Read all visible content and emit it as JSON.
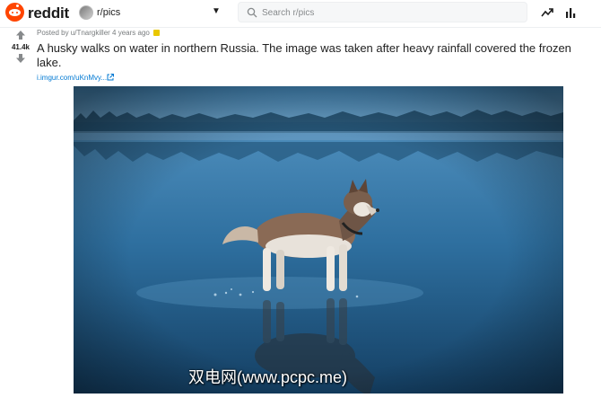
{
  "header": {
    "wordmark": "reddit",
    "subreddit": "r/pics",
    "search_placeholder": "Search r/pics",
    "icons": [
      "reddit-logo-icon",
      "chevron-down-icon",
      "search-icon",
      "trending-icon",
      "stats-icon"
    ],
    "brand_color": "#ff4500"
  },
  "post": {
    "score": "41.4k",
    "meta": "Posted by u/Tnargkiller 4 years ago",
    "title": "A husky walks on water in northern Russia. The image was taken after heavy rainfall covered the frozen lake.",
    "link_text": "i.imgur.com/uKnMvy...",
    "image_watermark": "双电网(www.pcpc.me)",
    "icons": [
      "upvote-icon",
      "downvote-icon",
      "award-icon",
      "external-link-icon"
    ]
  }
}
